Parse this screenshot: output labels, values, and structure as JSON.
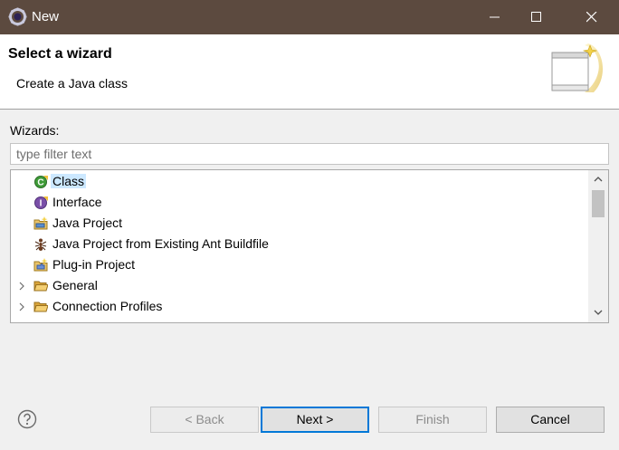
{
  "window": {
    "title": "New"
  },
  "header": {
    "title": "Select a wizard",
    "description": "Create a Java class"
  },
  "body": {
    "wizards_label": "Wizards:",
    "filter_placeholder": "type filter text",
    "filter_value": ""
  },
  "tree": {
    "items": [
      {
        "label": "Class",
        "icon": "java-class-icon",
        "selected": true,
        "expandable": false
      },
      {
        "label": "Interface",
        "icon": "java-interface-icon",
        "selected": false,
        "expandable": false
      },
      {
        "label": "Java Project",
        "icon": "java-project-icon",
        "selected": false,
        "expandable": false
      },
      {
        "label": "Java Project from Existing Ant Buildfile",
        "icon": "ant-icon",
        "selected": false,
        "expandable": false
      },
      {
        "label": "Plug-in Project",
        "icon": "plugin-project-icon",
        "selected": false,
        "expandable": false
      },
      {
        "label": "General",
        "icon": "folder-icon",
        "selected": false,
        "expandable": true
      },
      {
        "label": "Connection Profiles",
        "icon": "folder-icon",
        "selected": false,
        "expandable": true
      }
    ]
  },
  "footer": {
    "back_label": "< Back",
    "next_label": "Next >",
    "finish_label": "Finish",
    "cancel_label": "Cancel"
  },
  "colors": {
    "titlebar": "#5c4a3f",
    "selection": "#cce8ff",
    "default_button_border": "#0078d7"
  }
}
